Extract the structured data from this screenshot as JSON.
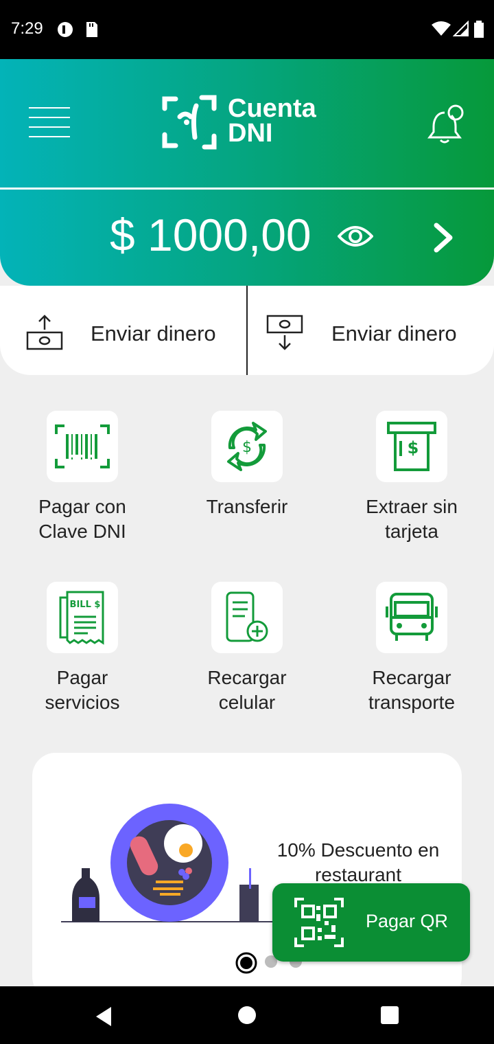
{
  "status_bar": {
    "time": "7:29"
  },
  "header": {
    "logo_line1": "Cuenta",
    "logo_line2": "DNI",
    "balance": "$ 1000,00"
  },
  "actions": [
    {
      "label": "Enviar dinero"
    },
    {
      "label": "Enviar dinero"
    }
  ],
  "grid": [
    {
      "label": "Pagar con\nClave DNI",
      "icon": "barcode-icon"
    },
    {
      "label": "Transferir",
      "icon": "transfer-icon"
    },
    {
      "label": "Extraer sin\ntarjeta",
      "icon": "atm-icon"
    },
    {
      "label": "Pagar\nservicios",
      "icon": "bill-icon"
    },
    {
      "label": "Recargar\ncelular",
      "icon": "phone-recharge-icon"
    },
    {
      "label": "Recargar\ntransporte",
      "icon": "bus-icon"
    }
  ],
  "promo": {
    "text": "10% Descuento en restaurant"
  },
  "qr_button": {
    "label": "Pagar QR"
  },
  "colors": {
    "accent": "#0b8e34",
    "gradient_start": "#03b3b8",
    "gradient_end": "#06993a"
  }
}
